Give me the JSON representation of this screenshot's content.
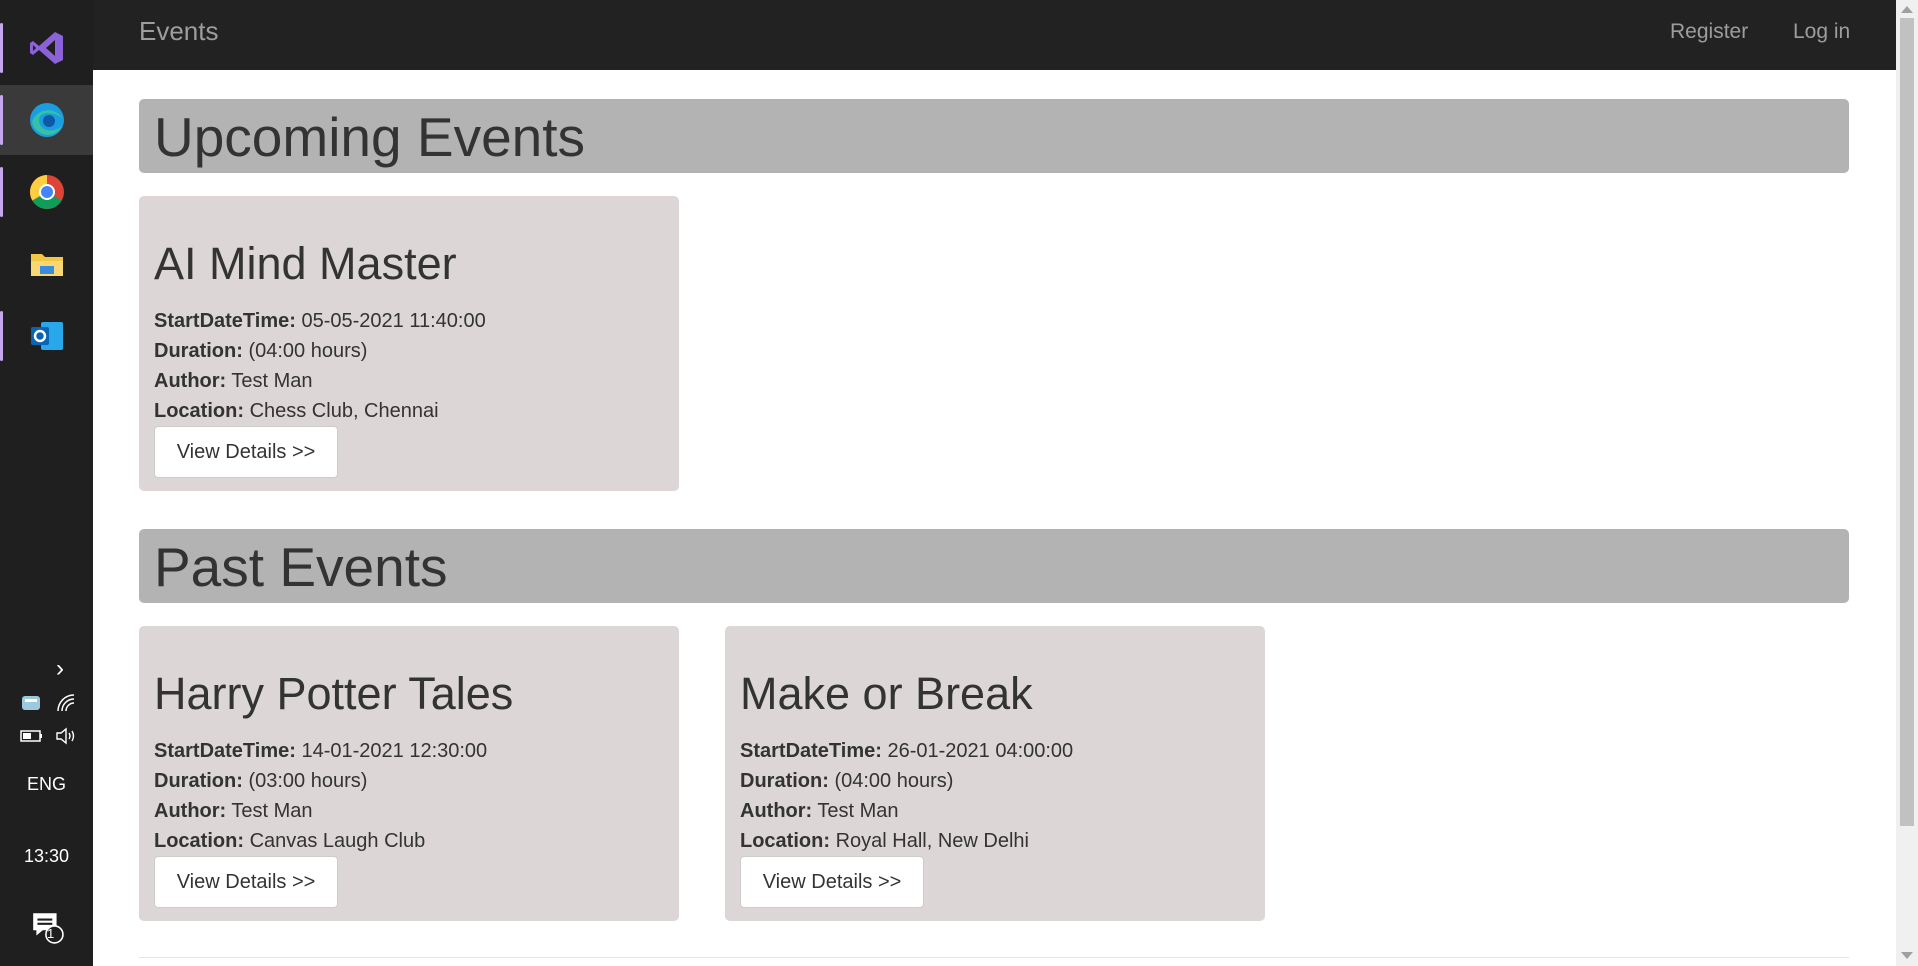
{
  "navbar": {
    "brand": "Events",
    "links": [
      "Register",
      "Log in"
    ]
  },
  "tray": {
    "language": "ENG",
    "time": "13:30",
    "notification_count": "1"
  },
  "sections": [
    {
      "title": "Upcoming Events",
      "events": [
        {
          "name": "AI Mind Master",
          "start_label": "StartDateTime:",
          "start": "05-05-2021 11:40:00",
          "duration_label": "Duration:",
          "duration": "(04:00 hours)",
          "author_label": "Author:",
          "author": "Test Man",
          "location_label": "Location:",
          "location": "Chess Club, Chennai",
          "button": "View Details >>"
        }
      ]
    },
    {
      "title": "Past Events",
      "events": [
        {
          "name": "Harry Potter Tales",
          "start_label": "StartDateTime:",
          "start": "14-01-2021 12:30:00",
          "duration_label": "Duration:",
          "duration": "(03:00 hours)",
          "author_label": "Author:",
          "author": "Test Man",
          "location_label": "Location:",
          "location": "Canvas Laugh Club",
          "button": "View Details >>"
        },
        {
          "name": "Make or Break",
          "start_label": "StartDateTime:",
          "start": "26-01-2021 04:00:00",
          "duration_label": "Duration:",
          "duration": "(04:00 hours)",
          "author_label": "Author:",
          "author": "Test Man",
          "location_label": "Location:",
          "location": "Royal Hall, New Delhi",
          "button": "View Details >>"
        }
      ]
    }
  ]
}
